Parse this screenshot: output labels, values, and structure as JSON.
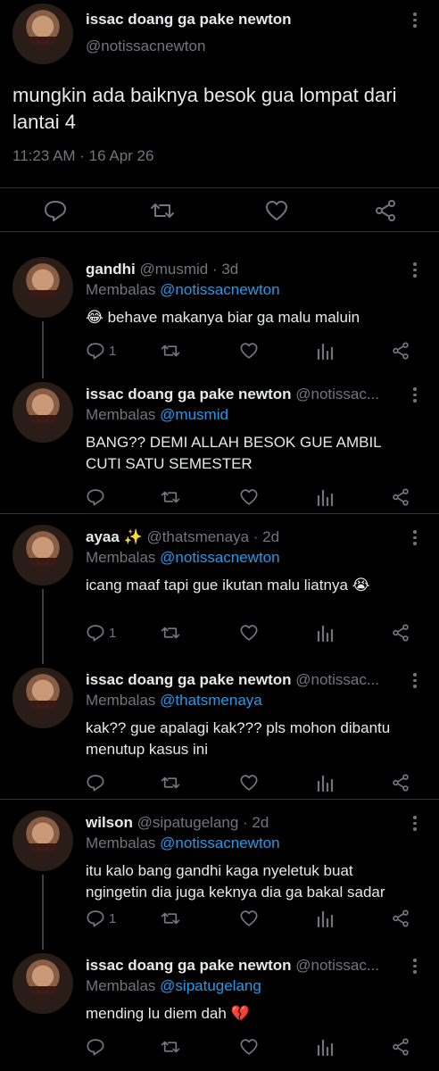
{
  "main_tweet": {
    "author_name": "issac doang ga pake newton",
    "handle": "@notissacnewton",
    "text": "mungkin ada baiknya besok gua lompat dari lantai 4",
    "timestamp": "11:23 AM · 16 Apr 26",
    "actions": [
      "reply-icon",
      "retweet-icon",
      "like-icon",
      "share-icon"
    ]
  },
  "replies": [
    {
      "name": "gandhi",
      "handle_meta": "@musmid · 3d",
      "replying_prefix": "Membalas",
      "replying_to": "@notissacnewton",
      "text": "😂 behave makanya biar ga malu maluin",
      "reply_count": "1"
    },
    {
      "name": "issac doang ga pake newton",
      "handle_meta": "@notissac...",
      "replying_prefix": "Membalas",
      "replying_to": "@musmid",
      "text": "BANG?? DEMI ALLAH BESOK GUE AMBIL CUTI SATU SEMESTER",
      "reply_count": ""
    },
    {
      "name": "ayaa ✨",
      "handle_meta": "@thatsmenaya · 2d",
      "replying_prefix": "Membalas",
      "replying_to": "@notissacnewton",
      "text": "icang maaf tapi gue ikutan malu liatnya 😭",
      "reply_count": "1"
    },
    {
      "name": "issac doang ga pake newton",
      "handle_meta": "@notissac...",
      "replying_prefix": "Membalas",
      "replying_to": "@thatsmenaya",
      "text": "kak?? gue apalagi kak??? pls mohon dibantu menutup kasus ini",
      "reply_count": ""
    },
    {
      "name": "wilson",
      "handle_meta": "@sipatugelang · 2d",
      "replying_prefix": "Membalas",
      "replying_to": "@notissacnewton",
      "text": "itu kalo bang gandhi kaga nyeletuk buat ngingetin dia juga keknya dia ga bakal sadar",
      "reply_count": "1"
    },
    {
      "name": "issac doang ga pake newton",
      "handle_meta": "@notissac...",
      "replying_prefix": "Membalas",
      "replying_to": "@sipatugelang",
      "text": "mending lu diem dah 💔",
      "reply_count": ""
    }
  ],
  "colors": {
    "background": "#000000",
    "text": "#e7e9ea",
    "muted": "#71767b",
    "link": "#1d9bf0",
    "divider": "#2f3336"
  }
}
